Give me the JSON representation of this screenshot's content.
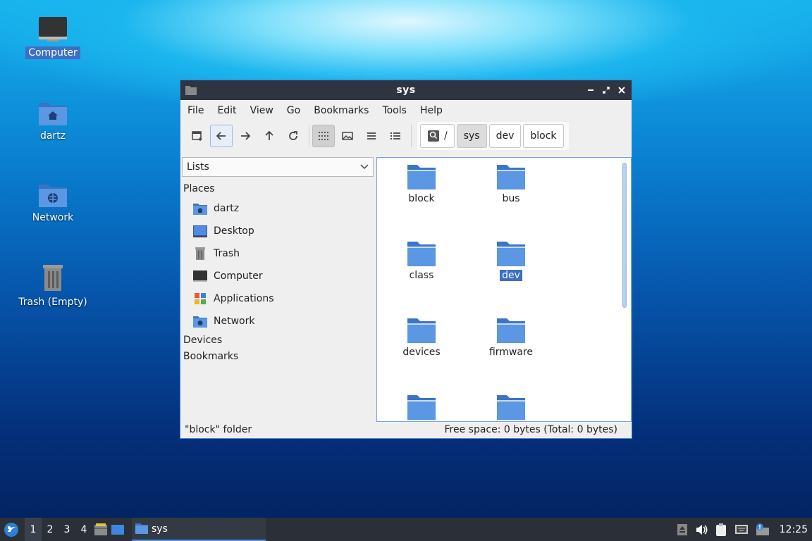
{
  "desktop": {
    "icons": [
      {
        "label": "Computer",
        "icon": "computer-icon"
      },
      {
        "label": "dartz",
        "icon": "home-folder-icon"
      },
      {
        "label": "Network",
        "icon": "network-folder-icon"
      },
      {
        "label": "Trash (Empty)",
        "icon": "trash-icon"
      }
    ]
  },
  "window": {
    "title": "sys",
    "menu": [
      "File",
      "Edit",
      "View",
      "Go",
      "Bookmarks",
      "Tools",
      "Help"
    ],
    "breadcrumbs": [
      "/",
      "sys",
      "dev",
      "block"
    ],
    "side_combo": "Lists",
    "sections": {
      "places": "Places",
      "devices": "Devices",
      "bookmarks": "Bookmarks"
    },
    "places": [
      {
        "label": "dartz",
        "icon": "home-folder-icon"
      },
      {
        "label": "Desktop",
        "icon": "desktop-icon"
      },
      {
        "label": "Trash",
        "icon": "trash-icon"
      },
      {
        "label": "Computer",
        "icon": "computer-icon"
      },
      {
        "label": "Applications",
        "icon": "applications-icon"
      },
      {
        "label": "Network",
        "icon": "network-folder-icon"
      }
    ],
    "files": [
      "block",
      "bus",
      "class",
      "dev",
      "devices",
      "firmware",
      "",
      ""
    ],
    "selected_file": "dev",
    "status_left": "\"block\" folder",
    "status_right": "Free space: 0 bytes (Total: 0 bytes)"
  },
  "taskbar": {
    "workspaces": [
      "1",
      "2",
      "3",
      "4"
    ],
    "active_workspace": "1",
    "task_label": "sys",
    "clock": "12:25"
  },
  "colors": {
    "folder": "#4a86d6",
    "selection": "#3d6fc6",
    "titlebar": "#2e3440",
    "taskbar": "#2b3038"
  }
}
